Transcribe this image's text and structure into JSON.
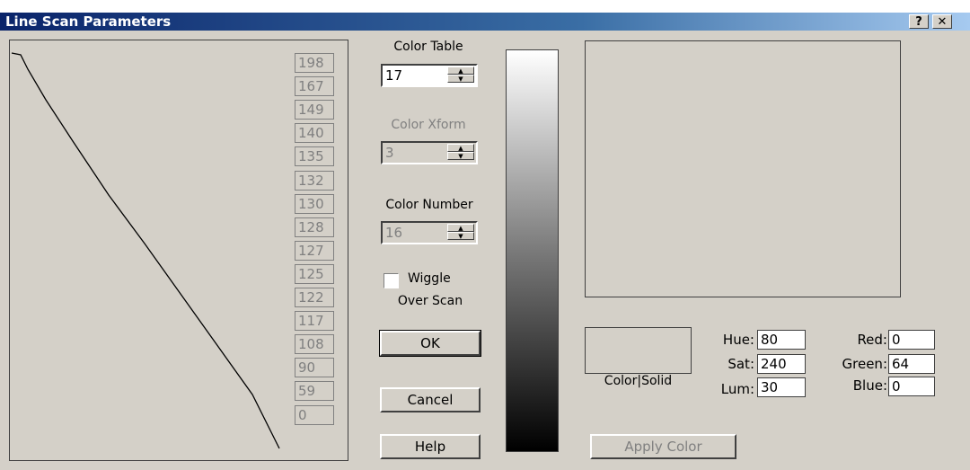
{
  "window": {
    "title": "Line Scan Parameters",
    "help_glyph": "?",
    "close_glyph": "✕"
  },
  "scan_values": [
    "198",
    "167",
    "149",
    "140",
    "135",
    "132",
    "130",
    "128",
    "127",
    "125",
    "122",
    "117",
    "108",
    "90",
    "59",
    "0"
  ],
  "color_table": {
    "label": "Color Table",
    "value": "17"
  },
  "color_xform": {
    "label": "Color  Xform",
    "value": "3"
  },
  "color_number": {
    "label": "Color Number",
    "value": "16"
  },
  "wiggle": {
    "label": "Wiggle",
    "checked": false
  },
  "over_scan": {
    "label": "Over Scan"
  },
  "buttons": {
    "ok": "OK",
    "cancel": "Cancel",
    "help": "Help",
    "apply_color": "Apply Color"
  },
  "color_solid_label": "Color|Solid",
  "hsl": {
    "hue_label": "Hue:",
    "hue": "80",
    "sat_label": "Sat:",
    "sat": "240",
    "lum_label": "Lum:",
    "lum": "30"
  },
  "rgb": {
    "red_label": "Red:",
    "red": "0",
    "green_label": "Green:",
    "green": "64",
    "blue_label": "Blue:",
    "blue": "0"
  },
  "colors": {
    "titlebar_start": "#0a246a",
    "dialog_face": "#d4d0c8"
  }
}
